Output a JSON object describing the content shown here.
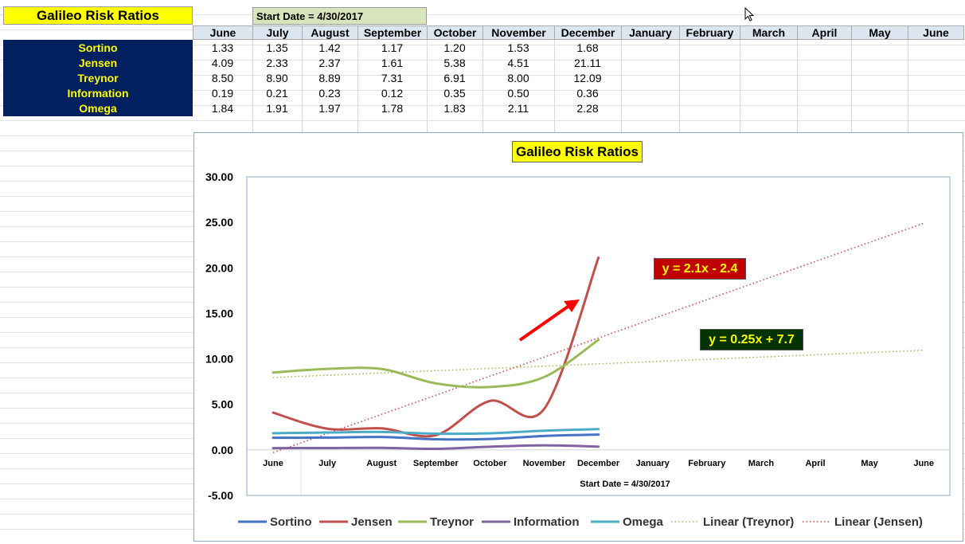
{
  "sheet": {
    "title": "Galileo Risk Ratios",
    "start_date_label": "Start Date = 4/30/2017",
    "months": [
      "June",
      "July",
      "August",
      "September",
      "October",
      "November",
      "December",
      "January",
      "February",
      "March",
      "April",
      "May",
      "June"
    ],
    "rows": [
      {
        "label": "Sortino",
        "values": [
          "1.33",
          "1.35",
          "1.42",
          "1.17",
          "1.20",
          "1.53",
          "1.68"
        ]
      },
      {
        "label": "Jensen",
        "values": [
          "4.09",
          "2.33",
          "2.37",
          "1.61",
          "5.38",
          "4.51",
          "21.11"
        ]
      },
      {
        "label": "Treynor",
        "values": [
          "8.50",
          "8.90",
          "8.89",
          "7.31",
          "6.91",
          "8.00",
          "12.09"
        ]
      },
      {
        "label": "Information",
        "values": [
          "0.19",
          "0.21",
          "0.23",
          "0.12",
          "0.35",
          "0.50",
          "0.36"
        ]
      },
      {
        "label": "Omega",
        "values": [
          "1.84",
          "1.91",
          "1.97",
          "1.78",
          "1.83",
          "2.11",
          "2.28"
        ]
      }
    ]
  },
  "chart_data": {
    "type": "line",
    "title": "Galileo Risk Ratios",
    "xlabel": "Start Date = 4/30/2017",
    "ylabel": "",
    "categories": [
      "June",
      "July",
      "August",
      "September",
      "October",
      "November",
      "December",
      "January",
      "February",
      "March",
      "April",
      "May",
      "June"
    ],
    "ylim": [
      -5,
      30
    ],
    "yticks": [
      "30.00",
      "25.00",
      "20.00",
      "15.00",
      "10.00",
      "5.00",
      "0.00",
      "-5.00"
    ],
    "series": [
      {
        "name": "Sortino",
        "color": "#4472c4",
        "values": [
          1.33,
          1.35,
          1.42,
          1.17,
          1.2,
          1.53,
          1.68
        ]
      },
      {
        "name": "Jensen",
        "color": "#c0504d",
        "values": [
          4.09,
          2.33,
          2.37,
          1.61,
          5.38,
          4.51,
          21.11
        ]
      },
      {
        "name": "Treynor",
        "color": "#9bbb59",
        "values": [
          8.5,
          8.9,
          8.89,
          7.31,
          6.91,
          8.0,
          12.09
        ]
      },
      {
        "name": "Information",
        "color": "#8064a2",
        "values": [
          0.19,
          0.21,
          0.23,
          0.12,
          0.35,
          0.5,
          0.36
        ]
      },
      {
        "name": "Omega",
        "color": "#4bacc6",
        "values": [
          1.84,
          1.91,
          1.97,
          1.78,
          1.83,
          2.11,
          2.28
        ]
      }
    ],
    "trendlines": [
      {
        "name": "Linear (Treynor)",
        "color": "#9bbb59",
        "slope": 0.25,
        "intercept": 7.7,
        "label": "y = 0.25x + 7.7",
        "label_bg": "#003300",
        "label_color": "#ffff00"
      },
      {
        "name": "Linear (Jensen)",
        "color": "#c0504d",
        "slope": 2.1,
        "intercept": -2.4,
        "label": "y = 2.1x - 2.4",
        "label_bg": "#c00000",
        "label_color": "#ffff00"
      }
    ],
    "annotation": {
      "type": "arrow",
      "color": "#ff0000",
      "points_to": "Jensen December"
    }
  }
}
